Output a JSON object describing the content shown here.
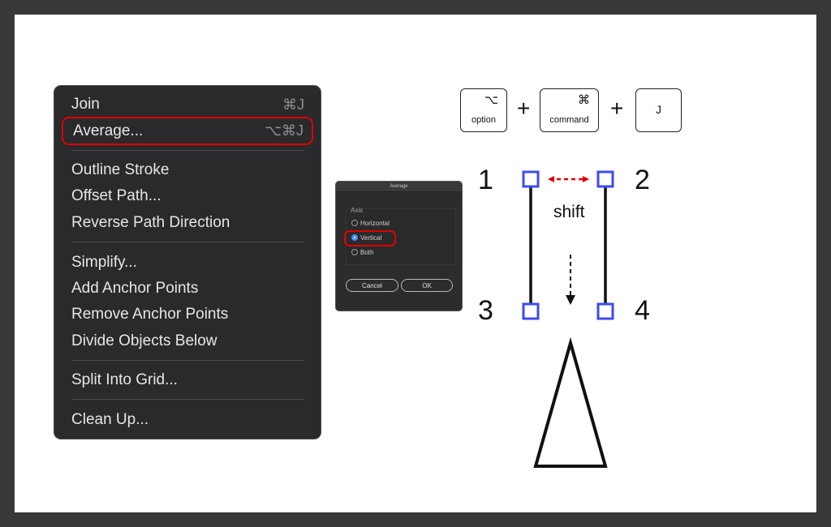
{
  "menu": {
    "items": [
      {
        "label": "Join",
        "shortcut": "⌘J"
      },
      {
        "label": "Average...",
        "shortcut": "⌥⌘J",
        "highlighted": true
      },
      {
        "label": "Outline Stroke",
        "shortcut": ""
      },
      {
        "label": "Offset Path...",
        "shortcut": ""
      },
      {
        "label": "Reverse Path Direction",
        "shortcut": ""
      },
      {
        "label": "Simplify...",
        "shortcut": ""
      },
      {
        "label": "Add Anchor Points",
        "shortcut": ""
      },
      {
        "label": "Remove Anchor Points",
        "shortcut": ""
      },
      {
        "label": "Divide Objects Below",
        "shortcut": ""
      },
      {
        "label": "Split Into Grid...",
        "shortcut": ""
      },
      {
        "label": "Clean Up...",
        "shortcut": ""
      }
    ]
  },
  "dialog": {
    "title": "Average",
    "group_label": "Axis",
    "options": [
      {
        "label": "Horizontal",
        "selected": false
      },
      {
        "label": "Vertical",
        "selected": true
      },
      {
        "label": "Both",
        "selected": false
      }
    ],
    "cancel_label": "Cancel",
    "ok_label": "OK"
  },
  "shortcut_keys": {
    "option": {
      "symbol": "⌥",
      "name": "option"
    },
    "command": {
      "symbol": "⌘",
      "name": "command"
    },
    "j": {
      "label": "J"
    },
    "plus": "+"
  },
  "diagram": {
    "points": [
      "1",
      "2",
      "3",
      "4"
    ],
    "shift_label": "shift",
    "colors": {
      "anchor": "#3b4cf0",
      "arrow_red": "#e00000",
      "highlight_red": "#e00000",
      "radio_selected": "#4a90ff"
    }
  }
}
